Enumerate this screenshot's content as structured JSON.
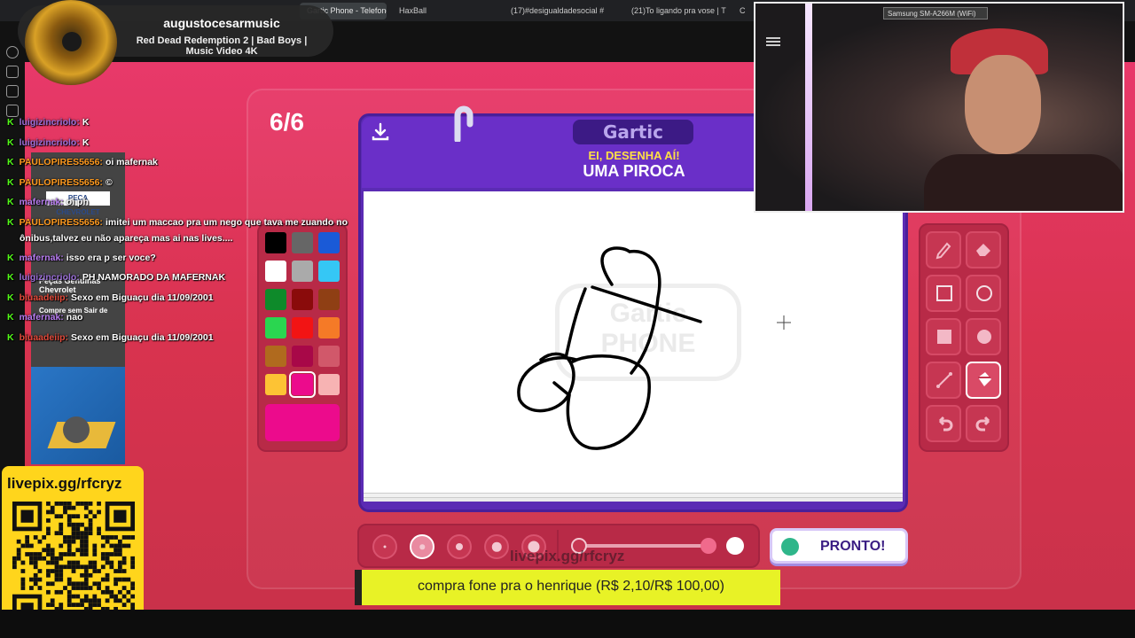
{
  "browser": {
    "tabs": [
      {
        "label": "Gartic Phone - Telefone sem fio",
        "active": true
      },
      {
        "label": "HaxBall"
      },
      {
        "label": "(17)#desigualdadesocial #"
      },
      {
        "label": "(21)To ligando pra vose | T"
      },
      {
        "label": "C"
      }
    ]
  },
  "music": {
    "artist": "augustocesarmusic",
    "song": "Red Dead Redemption 2 | Bad Boys | Music Video 4K"
  },
  "webcam": {
    "device": "Samsung SM-A266M (WiFi)"
  },
  "chat": [
    {
      "user": "luigizincriolo:",
      "text": "K",
      "color": "#9b6fd8"
    },
    {
      "user": "luigizincriolo:",
      "text": "K",
      "color": "#9b6fd8"
    },
    {
      "user": "PAULOPIRES5656:",
      "text": "oi mafernak",
      "color": "#ff9a1f"
    },
    {
      "user": "PAULOPIRES5656:",
      "text": "©",
      "color": "#ff9a1f"
    },
    {
      "user": "mafernak:",
      "text": "oi ph",
      "color": "#b77cf0"
    },
    {
      "user": "PAULOPIRES5656:",
      "text": "imitei um maccao pra um nego que tava me zuando no",
      "cont": "ônibus,talvez eu não apareça mas ai nas lives....",
      "color": "#ff9a1f"
    },
    {
      "user": "mafernak:",
      "text": "isso era p ser voce?",
      "color": "#b77cf0"
    },
    {
      "user": "luigizincriolo:",
      "text": "PH NAMORADO DA MAFERNAK",
      "color": "#9b6fd8"
    },
    {
      "user": "biuaadeiip:",
      "text": "Sexo em Biguaçu dia 11/09/2001",
      "color": "#e24a3b"
    },
    {
      "user": "mafernak:",
      "text": "nao",
      "color": "#b77cf0"
    },
    {
      "user": "biuaadeiip:",
      "text": "Sexo em Biguaçu dia 11/09/2001",
      "color": "#e24a3b"
    }
  ],
  "ad": {
    "brand": "PEÇA CHEVROLET",
    "line1": "Peças Genuínas Chevrolet",
    "line2": "Compre sem Sair de"
  },
  "game": {
    "round": "6/6",
    "logo": "Gartic",
    "prompt_top": "EI, DESENHA AÍ!",
    "prompt_word": "UMA PIROCA",
    "watermark": "Gartic PHONE",
    "done_label": "PRONTO!",
    "palette": [
      "#000000",
      "#666666",
      "#1a5ad7",
      "#ffffff",
      "#aaaaaa",
      "#35c7f5",
      "#0e8a2a",
      "#8a0b0b",
      "#8f3f14",
      "#2ad650",
      "#f21414",
      "#f57a27",
      "#b06a1e",
      "#a80848",
      "#d1586a",
      "#fdc334",
      "#ec0b8c",
      "#f7b3b3"
    ],
    "selected_color": "#ec0b8c",
    "tools": [
      "pencil-icon",
      "eraser-icon",
      "rectangle-outline-icon",
      "circle-outline-icon",
      "rectangle-filled-icon",
      "circle-filled-icon",
      "line-icon",
      "fill-bucket-icon",
      "undo-icon",
      "redo-icon"
    ],
    "selected_tool": "fill-bucket-icon",
    "brush_sizes": 5,
    "selected_brush": 2,
    "opacity": 0.98
  },
  "livepix": {
    "url": "livepix.gg/rfcryz",
    "watermark": "livepix.gg/rfcryz"
  },
  "donation": {
    "text": "compra fone pra o henrique (R$ 2,10/R$ 100,00)"
  }
}
